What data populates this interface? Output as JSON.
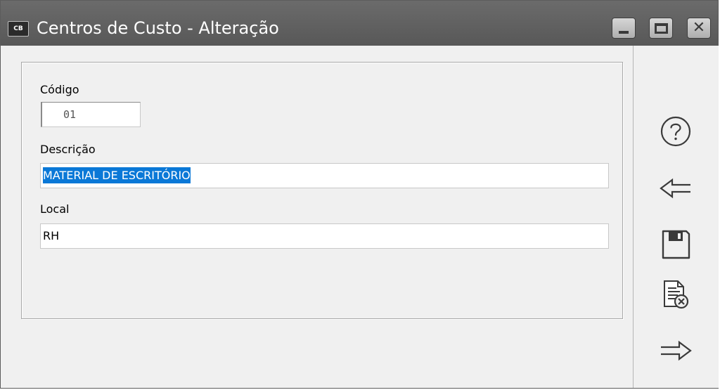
{
  "window": {
    "app_icon_text": "CB",
    "title": "Centros de Custo - Alteração"
  },
  "form": {
    "codigo": {
      "label": "Código",
      "value": "01"
    },
    "descricao": {
      "label": "Descrição",
      "value": "MATERIAL DE ESCRITÓRIO",
      "selected": true
    },
    "local": {
      "label": "Local",
      "value": "RH"
    }
  },
  "sidebar": {
    "buttons": [
      {
        "name": "help",
        "icon": "help-icon"
      },
      {
        "name": "back",
        "icon": "arrow-left-icon"
      },
      {
        "name": "save",
        "icon": "save-icon"
      },
      {
        "name": "cancel",
        "icon": "document-cancel-icon"
      },
      {
        "name": "next",
        "icon": "arrow-right-icon"
      }
    ]
  },
  "colors": {
    "titlebar": "#5f5f5f",
    "selection": "#0a78d7"
  }
}
